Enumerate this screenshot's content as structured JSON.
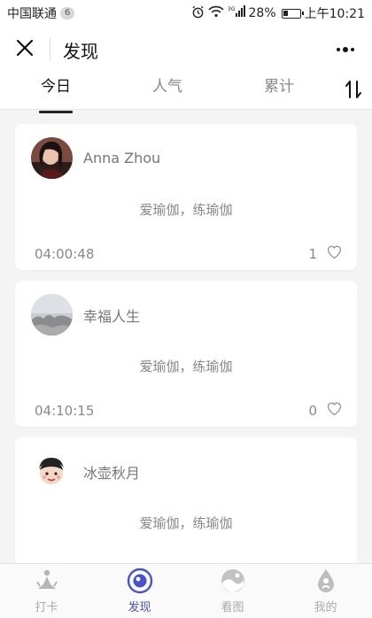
{
  "status_bar": {
    "carrier": "中国联通",
    "carrier_badge": "6",
    "network": "3G",
    "battery": "28%",
    "time": "上午10:21"
  },
  "nav": {
    "title": "发现",
    "close_icon": "close-icon",
    "more_icon": "more-dots-icon"
  },
  "tabs": [
    {
      "label": "今日",
      "active": true
    },
    {
      "label": "人气",
      "active": false
    },
    {
      "label": "累计",
      "active": false
    }
  ],
  "sort_icon": "sort-arrows-icon",
  "cards": [
    {
      "user": "Anna Zhou",
      "text": "爱瑜伽，练瑜伽",
      "duration": "04:00:48",
      "likes": "1"
    },
    {
      "user": "幸福人生",
      "text": "爱瑜伽，练瑜伽",
      "duration": "04:10:15",
      "likes": "0"
    },
    {
      "user": "冰壶秋月",
      "text": "爱瑜伽，练瑜伽",
      "duration": "",
      "likes": ""
    }
  ],
  "bottom_tabs": [
    {
      "label": "打卡",
      "icon": "meditation-figure-icon",
      "active": false
    },
    {
      "label": "发现",
      "icon": "discover-eye-icon",
      "active": true
    },
    {
      "label": "看图",
      "icon": "picture-icon",
      "active": false
    },
    {
      "label": "我的",
      "icon": "profile-drop-icon",
      "active": false
    }
  ],
  "colors": {
    "accent": "#4a52c9",
    "inactive": "#aaaaaa"
  }
}
